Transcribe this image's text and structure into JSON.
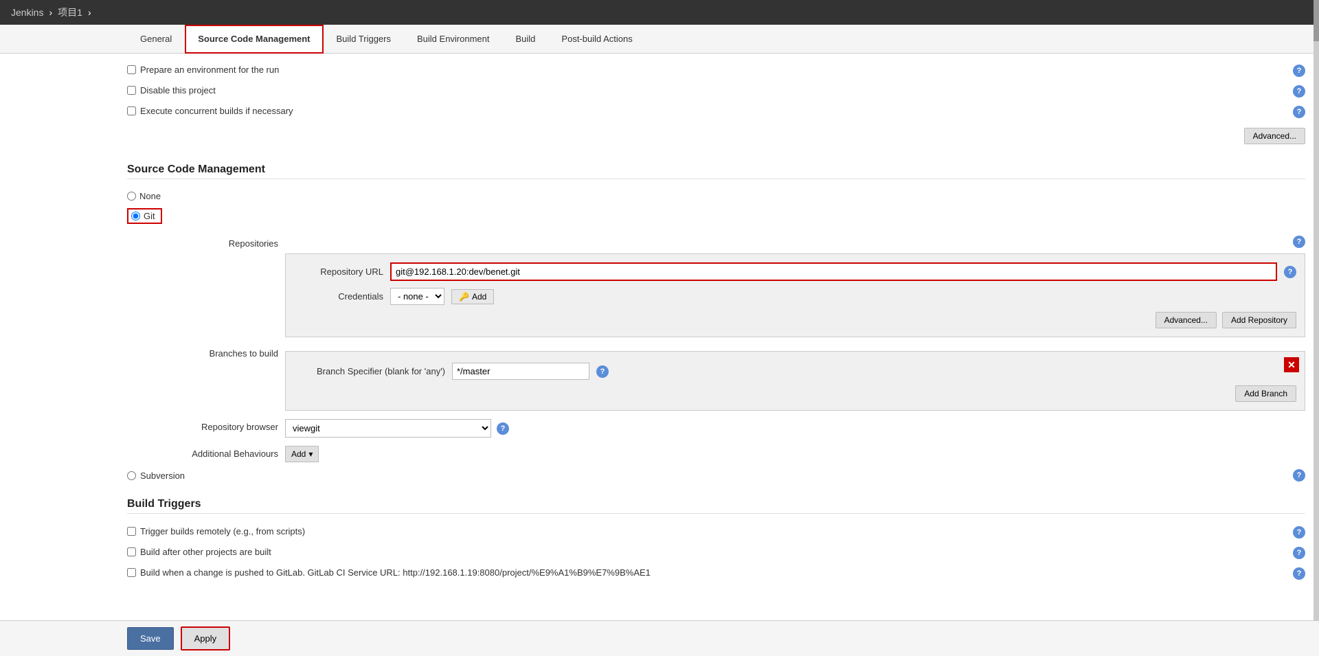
{
  "topbar": {
    "jenkins_label": "Jenkins",
    "project_label": "项目1",
    "arrow": "›"
  },
  "tabs": [
    {
      "id": "general",
      "label": "General",
      "active": false
    },
    {
      "id": "source-code-management",
      "label": "Source Code Management",
      "active": true
    },
    {
      "id": "build-triggers",
      "label": "Build Triggers",
      "active": false
    },
    {
      "id": "build-environment",
      "label": "Build Environment",
      "active": false
    },
    {
      "id": "build",
      "label": "Build",
      "active": false
    },
    {
      "id": "post-build-actions",
      "label": "Post-build Actions",
      "active": false
    }
  ],
  "general": {
    "checkbox1_label": "Prepare an environment for the run",
    "checkbox2_label": "Disable this project",
    "checkbox3_label": "Execute concurrent builds if necessary",
    "advanced_button": "Advanced..."
  },
  "scm": {
    "title": "Source Code Management",
    "none_label": "None",
    "git_label": "Git",
    "repositories_label": "Repositories",
    "repo_url_label": "Repository URL",
    "repo_url_value": "git@192.168.1.20:dev/benet.git",
    "repo_url_placeholder": "",
    "credentials_label": "Credentials",
    "credentials_value": "- none -",
    "credentials_add_label": "Add",
    "add_icon": "🔑",
    "advanced_btn": "Advanced...",
    "add_repository_btn": "Add Repository",
    "branches_title": "Branches to build",
    "branch_specifier_label": "Branch Specifier (blank for 'any')",
    "branch_specifier_value": "*/master",
    "add_branch_btn": "Add Branch",
    "repo_browser_label": "Repository browser",
    "repo_browser_value": "viewgit",
    "additional_behaviours_label": "Additional Behaviours",
    "add_btn": "Add",
    "subversion_label": "Subversion"
  },
  "build_triggers": {
    "title": "Build Triggers",
    "cb1_label": "Trigger builds remotely (e.g., from scripts)",
    "cb2_label": "Build after other projects are built",
    "cb3_label": "Build when a change is pushed to GitLab. GitLab CI Service URL: http://192.168.1.19:8080/project/%E9%A1%B9%E7%9B%AE1"
  },
  "footer": {
    "save_label": "Save",
    "apply_label": "Apply"
  }
}
